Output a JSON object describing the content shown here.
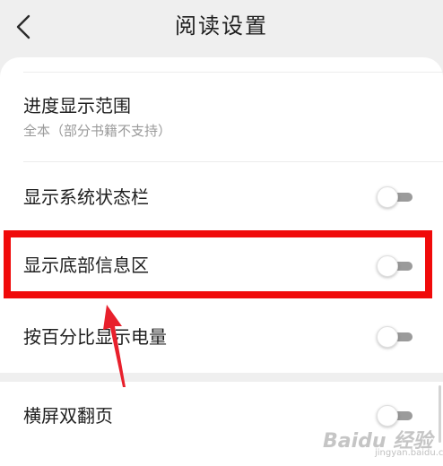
{
  "header": {
    "title": "阅读设置",
    "back_icon": "chevron-left-icon"
  },
  "settings": {
    "progress_range": {
      "label": "进度显示范围",
      "value": "全本（部分书籍不支持）"
    },
    "status_bar": {
      "label": "显示系统状态栏",
      "enabled": false
    },
    "bottom_info": {
      "label": "显示底部信息区",
      "enabled": false
    },
    "battery_percent": {
      "label": "按百分比显示电量",
      "enabled": false
    },
    "landscape_double": {
      "label": "横屏双翻页",
      "enabled": false
    }
  },
  "annotation": {
    "box_color": "#f00a0a",
    "arrow_color": "#e8202c"
  },
  "watermark": {
    "logo": "Baidu 经验",
    "sub": "jingyan.baidu.com"
  },
  "colors": {
    "background": "#efefef",
    "card": "#ffffff",
    "toggle_track_off": "#9b9b9b"
  }
}
